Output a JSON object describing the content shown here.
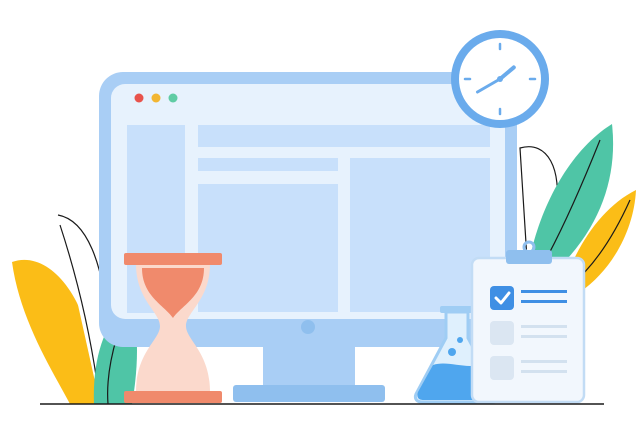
{
  "palette": {
    "monitor_frame": "#a9cef5",
    "screen_bg": "#e7f2fd",
    "screen_block": "#c8e0fb",
    "window_dot_red": "#e8534c",
    "window_dot_yellow": "#f2b632",
    "window_dot_green": "#5fcca4",
    "clock_ring": "#6aabec",
    "hourglass_frame": "#f08a6c",
    "hourglass_glass": "#fbd9cc",
    "leaf_yellow": "#fbbd17",
    "leaf_teal": "#4fc5a6",
    "flask_liquid": "#4fa6ee",
    "clipboard_check": "#3f8fe4",
    "ground_line": "#1a1a1a"
  },
  "icons": [
    "clock-icon",
    "hourglass-icon",
    "flask-icon",
    "clipboard-icon",
    "checkmark-icon",
    "leaf-icon"
  ],
  "clock": {
    "hour": 1,
    "minute": 40
  },
  "clipboard": {
    "items_checked": [
      true,
      false,
      false
    ]
  }
}
